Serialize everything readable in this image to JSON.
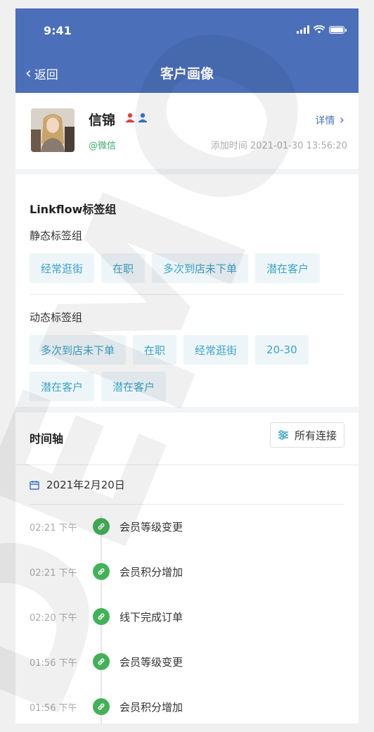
{
  "status_bar": {
    "time": "9:41"
  },
  "nav": {
    "back_label": "返回",
    "title": "客户画像"
  },
  "customer": {
    "name": "信锦",
    "detail_label": "详情",
    "source": "@微信",
    "added_time": "添加时间 2021-01-30 13:56:20"
  },
  "tags": {
    "group_title": "Linkflow标签组",
    "static_title": "静态标签组",
    "static_tags": [
      "经常逛街",
      "在职",
      "多次到店未下单",
      "潜在客户"
    ],
    "dynamic_title": "动态标签组",
    "dynamic_tags": [
      "多次到店未下单",
      "在职",
      "经常逛街",
      "20-30",
      "潜在客户",
      "潜在客户"
    ]
  },
  "timeline": {
    "title": "时间轴",
    "filter_label": "所有连接",
    "date": "2021年2月20日",
    "events": [
      {
        "time": "02:21 下午",
        "label": "会员等级变更"
      },
      {
        "time": "02:21 下午",
        "label": "会员积分增加"
      },
      {
        "time": "02:20 下午",
        "label": "线下完成订单"
      },
      {
        "time": "01:56 下午",
        "label": "会员等级变更"
      },
      {
        "time": "01:56 下午",
        "label": "会员积分增加"
      }
    ]
  },
  "watermark": {
    "text": "DEMO"
  },
  "colors": {
    "header": "#4b6fb8",
    "tag_bg": "#eef5f8",
    "tag_text": "#3aa3c9",
    "event_icon": "#45b05a"
  }
}
